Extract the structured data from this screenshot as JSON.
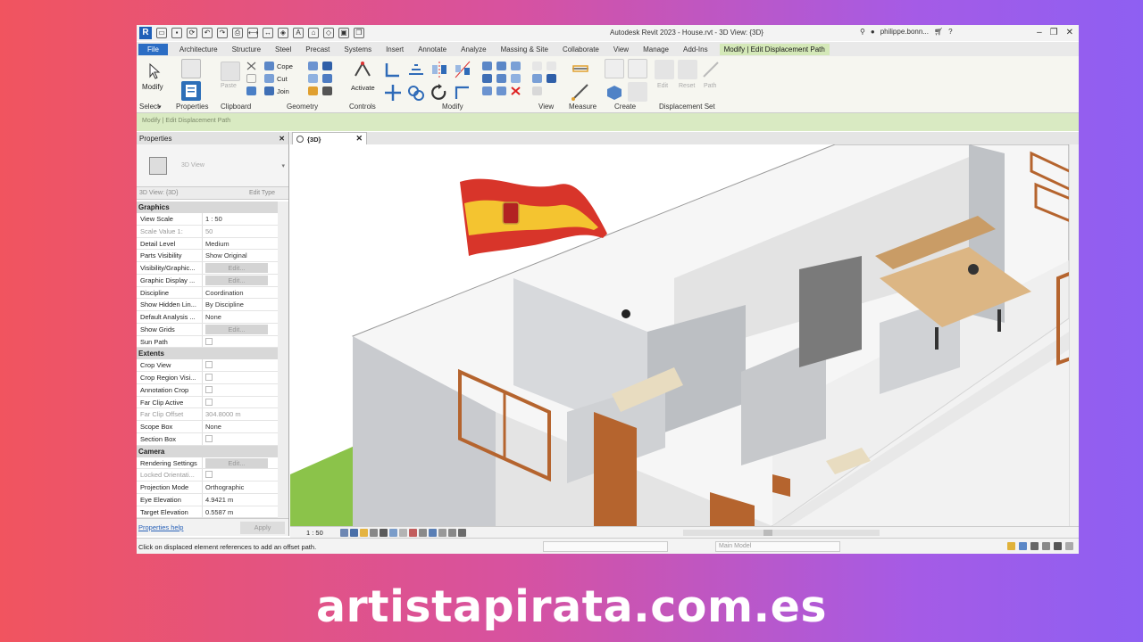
{
  "titlebar": {
    "title": "Autodesk Revit 2023 - House.rvt - 3D View: {3D}",
    "user": "philippe.bonn...",
    "help": "?"
  },
  "tabs": [
    "File",
    "Architecture",
    "Structure",
    "Steel",
    "Precast",
    "Systems",
    "Insert",
    "Annotate",
    "Analyze",
    "Massing & Site",
    "Collaborate",
    "View",
    "Manage",
    "Add-Ins",
    "Modify | Edit Displacement Path"
  ],
  "ribbon": {
    "modify_label": "Modify",
    "paste_label": "Paste",
    "cope_label": "Cope",
    "cut_label": "Cut",
    "join_label": "Join",
    "activate_label": "Activate",
    "edit_label": "Edit",
    "reset_label": "Reset",
    "path_label": "Path",
    "panels": [
      "Select",
      "Properties",
      "Clipboard",
      "Geometry",
      "Controls",
      "Modify",
      "View",
      "Measure",
      "Create",
      "Displacement Set"
    ],
    "context": "Modify | Edit Displacement Path"
  },
  "properties": {
    "header": "Properties",
    "type_name": "3D View",
    "instance_label": "3D View: {3D}",
    "edit_type": "Edit Type",
    "groups": [
      {
        "name": "Graphics",
        "rows": [
          {
            "k": "View Scale",
            "v": "1 : 50"
          },
          {
            "k": "Scale Value   1:",
            "v": "50",
            "dim": true
          },
          {
            "k": "Detail Level",
            "v": "Medium"
          },
          {
            "k": "Parts Visibility",
            "v": "Show Original"
          },
          {
            "k": "Visibility/Graphic...",
            "v": "Edit...",
            "btn": true
          },
          {
            "k": "Graphic Display ...",
            "v": "Edit...",
            "btn": true
          },
          {
            "k": "Discipline",
            "v": "Coordination"
          },
          {
            "k": "Show Hidden Lin...",
            "v": "By Discipline"
          },
          {
            "k": "Default Analysis ...",
            "v": "None"
          },
          {
            "k": "Show Grids",
            "v": "Edit...",
            "btn": true
          },
          {
            "k": "Sun Path",
            "v": "",
            "chk": true
          }
        ]
      },
      {
        "name": "Extents",
        "rows": [
          {
            "k": "Crop View",
            "v": "",
            "chk": true
          },
          {
            "k": "Crop Region Visi...",
            "v": "",
            "chk": true
          },
          {
            "k": "Annotation Crop",
            "v": "",
            "chk": true
          },
          {
            "k": "Far Clip Active",
            "v": "",
            "chk": true
          },
          {
            "k": "Far Clip Offset",
            "v": "304.8000 m",
            "dim": true
          },
          {
            "k": "Scope Box",
            "v": "None"
          },
          {
            "k": "Section Box",
            "v": "",
            "chk": true
          }
        ]
      },
      {
        "name": "Camera",
        "rows": [
          {
            "k": "Rendering Settings",
            "v": "Edit...",
            "btn": true
          },
          {
            "k": "Locked Orientati...",
            "v": "",
            "chk": true,
            "dim": true
          },
          {
            "k": "Projection Mode",
            "v": "Orthographic"
          },
          {
            "k": "Eye Elevation",
            "v": "4.9421 m"
          },
          {
            "k": "Target Elevation",
            "v": "0.5587 m"
          }
        ]
      }
    ],
    "help_link": "Properties help",
    "apply": "Apply"
  },
  "view": {
    "tab_label": "{3D}",
    "scale": "1 : 50"
  },
  "status": {
    "message": "Click on displaced element references to add an offset path.",
    "model": "Main Model"
  },
  "footer": "artistapirata.com.es",
  "colors": {
    "accent": "#2b6dc4",
    "context_tab": "#d4e8b8",
    "wood": "#b5642e",
    "grass": "#8bc34a"
  }
}
